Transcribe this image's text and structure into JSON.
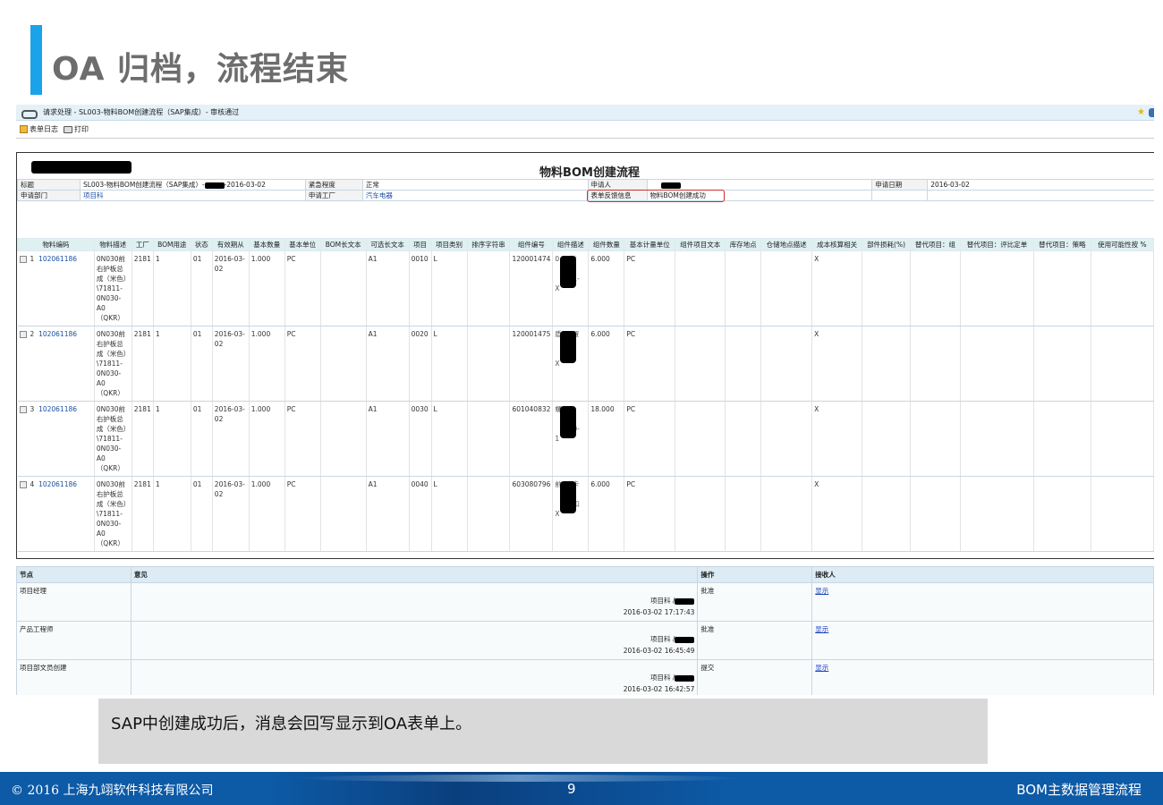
{
  "slide": {
    "title": "OA 归档，流程结束",
    "caption": "SAP中创建成功后，消息会回写显示到OA表单上。"
  },
  "oa": {
    "window_title": "请求处理 - SL003-物料BOM创建流程（SAP集成）- 审核通过",
    "toolbar": {
      "log_label": "表单日志",
      "print_label": "打印"
    },
    "form_title": "物料BOM创建流程",
    "header_fields": {
      "title_label": "标题",
      "title_value_prefix": "SL003-物料BOM创建流程（SAP集成）-",
      "title_value_suffix": "-2016-03-02",
      "urgency_label": "紧急程度",
      "urgency_value": "正常",
      "applicant_label": "申请人",
      "apply_date_label": "申请日期",
      "apply_date_value": "2016-03-02",
      "dept_label": "申请部门",
      "dept_value": "项目科",
      "plant_label": "申请工厂",
      "plant_value": "汽车电器",
      "feedback_label": "表单反馈信息",
      "feedback_value": "物料BOM创建成功"
    },
    "grid": {
      "columns": [
        "物料编码",
        "物料描述",
        "工厂",
        "BOM用途",
        "状态",
        "有效期从",
        "基本数量",
        "基本单位",
        "BOM长文本",
        "可选长文本",
        "项目",
        "项目类别",
        "排序字符串",
        "组件编号",
        "组件描述",
        "组件数量",
        "基本计量单位",
        "组件项目文本",
        "库存地点",
        "仓储地点描述",
        "成本核算相关",
        "部件损耗(%)",
        "替代项目：组",
        "替代项目：评比定单",
        "替代项目：策略",
        "使用可能性按 %"
      ],
      "rows": [
        {
          "no": "1",
          "material": "102061186",
          "desc": "0N030前右护板总成（米色）\\71811-0N030-A0（QKR）",
          "plant": "2181",
          "usage": "1",
          "status": "01",
          "valid_from": "2016-03-02",
          "qty": "1.000",
          "unit": "PC",
          "alt": "A1",
          "item": "0010",
          "cat": "L",
          "comp_no": "120001474",
          "comp_desc_a": "0",
          "comp_desc_b": "前",
          "comp_desc_c": "1-",
          "comp_desc_d": "X",
          "comp_qty": "6.000",
          "comp_unit": "PC",
          "cost": "X"
        },
        {
          "no": "2",
          "material": "102061186",
          "desc": "0N030前右护板总成（米色）\\71811-0N030-A0（QKR）",
          "plant": "2181",
          "usage": "1",
          "status": "01",
          "valid_from": "2016-03-02",
          "qty": "1.000",
          "unit": "PC",
          "alt": "A1",
          "item": "0020",
          "cat": "L",
          "comp_no": "120001475",
          "comp_desc_a": "盾",
          "comp_desc_b": "置",
          "comp_desc_c": "-",
          "comp_desc_d": "X",
          "comp_qty": "6.000",
          "comp_unit": "PC",
          "cost": "X"
        },
        {
          "no": "3",
          "material": "102061186",
          "desc": "0N030前右护板总成（米色）\\71811-0N030-A0（QKR）",
          "plant": "2181",
          "usage": "1",
          "status": "01",
          "valid_from": "2016-03-02",
          "qty": "1.000",
          "unit": "PC",
          "alt": "A1",
          "item": "0030",
          "cat": "L",
          "comp_no": "601040832",
          "comp_desc_a": "螺",
          "comp_desc_b": "",
          "comp_desc_c": "0-",
          "comp_desc_d": "1",
          "comp_qty": "18.000",
          "comp_unit": "PC",
          "cost": "X"
        },
        {
          "no": "4",
          "material": "102061186",
          "desc": "0N030前右护板总成（米色）\\71811-0N030-A0（QKR）",
          "plant": "2181",
          "usage": "1",
          "status": "01",
          "valid_from": "2016-03-02",
          "qty": "1.000",
          "unit": "PC",
          "alt": "A1",
          "item": "0040",
          "cat": "L",
          "comp_no": "603080796",
          "comp_desc_a": "前",
          "comp_desc_b": "卡",
          "comp_desc_c": "扣",
          "comp_desc_d": "X",
          "comp_qty": "6.000",
          "comp_unit": "PC",
          "cost": "X"
        }
      ]
    },
    "approval": {
      "headers": {
        "node": "节点",
        "opinion": "意见",
        "action": "操作",
        "receiver": "接收人"
      },
      "rows": [
        {
          "node": "项目经理",
          "signer": "项目科 /",
          "time": "2016-03-02  17:17:43",
          "action": "批准",
          "receiver": "显示"
        },
        {
          "node": "产品工程师",
          "signer": "项目科 /",
          "time": "2016-03-02  16:45:49",
          "action": "批准",
          "receiver": "显示"
        },
        {
          "node": "项目部文员创建",
          "signer": "项目科 /",
          "time": "2016-03-02  16:42:57",
          "action": "提交",
          "receiver": "显示"
        }
      ]
    }
  },
  "footer": {
    "copyright": "© 2016 上海九翊软件科技有限公司",
    "page": "9",
    "section": "BOM主数据管理流程"
  },
  "colors": {
    "accent": "#1aa3e8",
    "footer": "#0d5aa6",
    "highlight": "#d32b2b"
  }
}
